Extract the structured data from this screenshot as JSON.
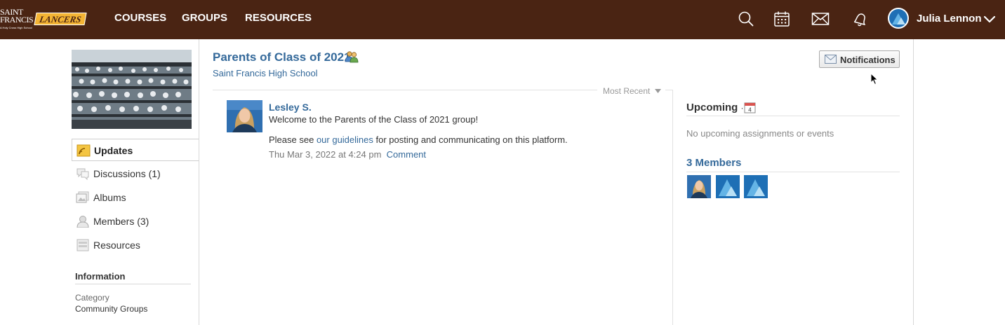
{
  "topbar": {
    "logo": {
      "school": "SAINT FRANCIS",
      "tagline": "A Holy Cross High School",
      "mascot": "LANCERS"
    },
    "nav": [
      {
        "label": "COURSES"
      },
      {
        "label": "GROUPS"
      },
      {
        "label": "RESOURCES"
      }
    ],
    "icons": [
      "search-icon",
      "calendar-icon",
      "mail-icon",
      "bell-icon"
    ],
    "user": {
      "name": "Julia Lennon"
    },
    "color": "#4a2413"
  },
  "sidebar": {
    "items": [
      {
        "label": "Updates",
        "icon": "updates-icon"
      },
      {
        "label": "Discussions (1)",
        "icon": "discussions-icon"
      },
      {
        "label": "Albums",
        "icon": "albums-icon"
      },
      {
        "label": "Members (3)",
        "icon": "members-icon"
      },
      {
        "label": "Resources",
        "icon": "resources-icon"
      }
    ],
    "info": {
      "heading": "Information",
      "category_key": "Category",
      "category_value": "Community Groups"
    }
  },
  "header": {
    "title": "Parents of Class of 2021",
    "subtitle": "Saint Francis High School",
    "notifications_label": "Notifications"
  },
  "feed": {
    "sort_label": "Most Recent",
    "posts": [
      {
        "author": "Lesley S.",
        "line1": "Welcome to the Parents of the Class of 2021 group!",
        "line2_prefix": "Please see ",
        "line2_link": "our guidelines",
        "line2_suffix": " for posting and communicating on this platform.",
        "timestamp": "Thu Mar 3, 2022 at 4:24 pm",
        "comment_label": "Comment"
      }
    ]
  },
  "rail": {
    "upcoming_heading": "Upcoming",
    "upcoming_separator": "·",
    "calendar_day": "4",
    "upcoming_empty": "No upcoming assignments or events",
    "members_heading": "3 Members"
  },
  "colors": {
    "link": "#34699a",
    "accent": "#f4b434"
  }
}
